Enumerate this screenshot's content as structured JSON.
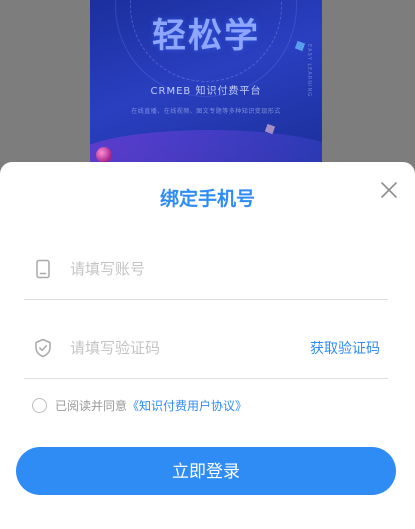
{
  "poster": {
    "title": "轻松学",
    "brand": "CRMEB 知识付费平台",
    "subtitle": "在线直播、在线视频、图文专题等多种知识变现形式",
    "side_text": "EASY LEARNING"
  },
  "dialog": {
    "title": "绑定手机号",
    "account_placeholder": "请填写账号",
    "code_placeholder": "请填写验证码",
    "get_code_label": "获取验证码",
    "agree_prefix": "已阅读并同意",
    "agreement_link": "《知识付费用户协议》",
    "login_label": "立即登录",
    "accent_color": "#2f8cf4"
  },
  "icons": {
    "close": "close-icon",
    "phone": "phone-icon",
    "shield": "shield-check-icon"
  }
}
